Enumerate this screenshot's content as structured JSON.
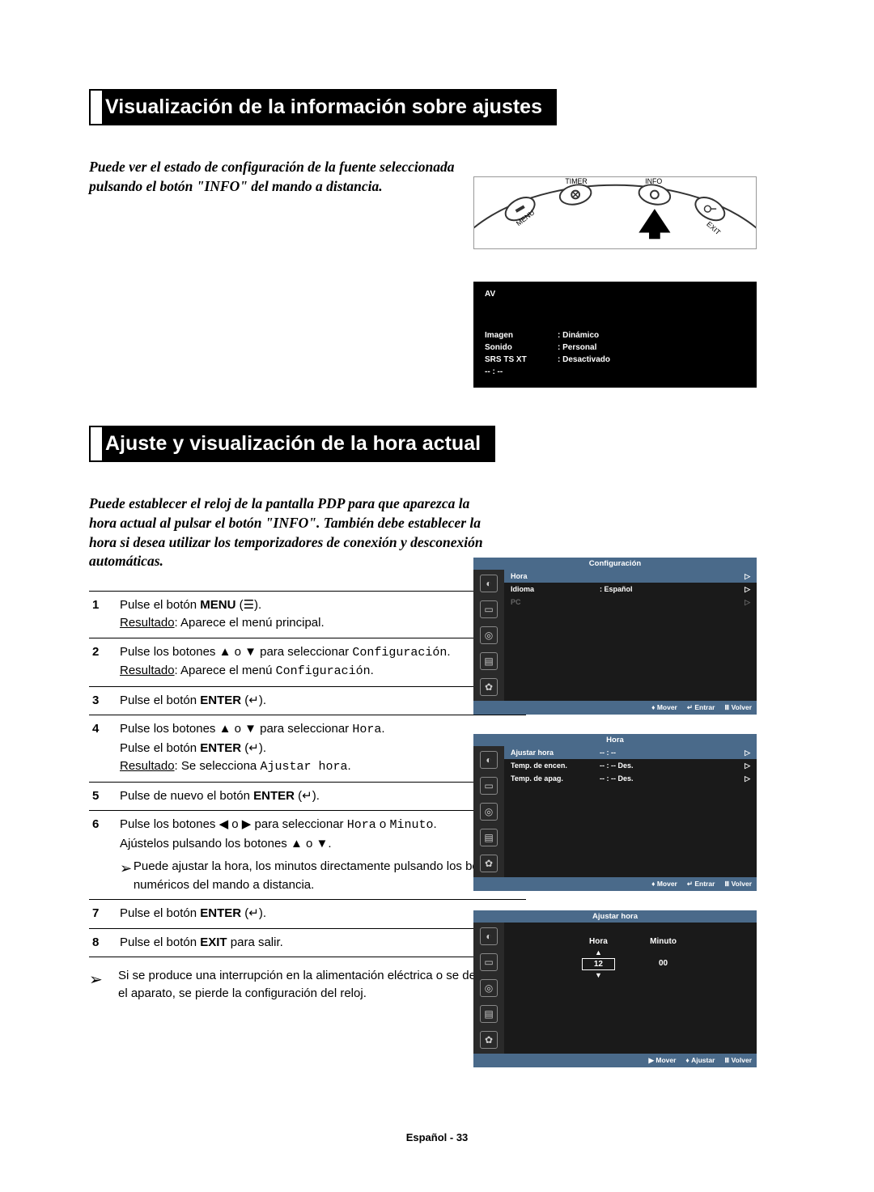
{
  "section1": {
    "title": "Visualización de la información sobre ajustes",
    "intro": "Puede ver el estado de configuración de la fuente seleccionada pulsando el botón \"INFO\" del mando a distancia."
  },
  "remote": {
    "labels": {
      "timer": "TIMER",
      "info": "INFO",
      "menu": "MENU",
      "exit": "EXIT"
    }
  },
  "osd_info": {
    "source": "AV",
    "rows": [
      {
        "label": "Imagen",
        "value": ": Dinámico"
      },
      {
        "label": "Sonido",
        "value": ": Personal"
      },
      {
        "label": "SRS TS XT",
        "value": ": Desactivado"
      },
      {
        "label": "-- : --",
        "value": ""
      }
    ]
  },
  "section2": {
    "title": "Ajuste y visualización de la hora actual",
    "intro": "Puede establecer el reloj de la pantalla PDP para que aparezca la hora actual al pulsar el botón \"INFO\". También debe establecer la hora si desea utilizar los temporizadores de conexión y desconexión automáticas.",
    "steps": [
      {
        "num": "1",
        "text_a": "Pulse el botón ",
        "bold_a": "MENU",
        "text_b": " (",
        "bold_icon": "☰",
        "text_c": ").",
        "result_label": "Resultado",
        "result_text": ":  Aparece el menú principal."
      },
      {
        "num": "2",
        "text_a": "Pulse los botones ▲ o ▼ para seleccionar ",
        "mono_a": "Configuración",
        "text_b": ".",
        "result_label": "Resultado",
        "result_text": ":  Aparece el menú ",
        "result_mono": "Configuración",
        "result_tail": "."
      },
      {
        "num": "3",
        "text_a": "Pulse el botón ",
        "bold_a": "ENTER",
        "text_b": " (↵)."
      },
      {
        "num": "4",
        "text_a": "Pulse los botones ▲ o ▼ para seleccionar ",
        "mono_a": "Hora",
        "text_b": ".",
        "line2_a": "Pulse el botón ",
        "line2_bold": "ENTER",
        "line2_b": " (↵).",
        "result_label": "Resultado",
        "result_text": ":  Se selecciona ",
        "result_mono": "Ajustar hora",
        "result_tail": "."
      },
      {
        "num": "5",
        "text_a": "Pulse de nuevo el botón ",
        "bold_a": "ENTER",
        "text_b": " (↵)."
      },
      {
        "num": "6",
        "text_a": "Pulse los botones ◀ o ▶ para seleccionar ",
        "mono_a": "Hora",
        "mid": " o ",
        "mono_b": "Minuto",
        "text_b": ".",
        "line2_plain": "Ajústelos pulsando los botones ▲ o ▼.",
        "inner_note_arrow": "➢",
        "inner_note": "Puede ajustar la hora, los minutos directamente pulsando los botones numéricos del mando a distancia."
      },
      {
        "num": "7",
        "text_a": "Pulse el botón ",
        "bold_a": "ENTER",
        "text_b": " (↵)."
      },
      {
        "num": "8",
        "text_a": "Pulse el botón ",
        "bold_a": "EXIT",
        "text_b": " para salir."
      }
    ],
    "footnote_arrow": "➢",
    "footnote": "Si se produce una interrupción en la alimentación eléctrica o se desconecta el aparato, se pierde la configuración del reloj."
  },
  "menu_config": {
    "title": "Configuración",
    "items": [
      {
        "label": "Hora",
        "value": "",
        "selected": true,
        "arrow": "▷"
      },
      {
        "label": "Idioma",
        "value": ": Español",
        "arrow": "▷"
      },
      {
        "label": "PC",
        "value": "",
        "dim": true,
        "arrow": "▷"
      }
    ],
    "footer": {
      "move": "Mover",
      "enter": "Entrar",
      "back": "Volver"
    }
  },
  "menu_hora": {
    "title": "Hora",
    "items": [
      {
        "label": "Ajustar hora",
        "value": "-- : --",
        "selected": true,
        "arrow": "▷"
      },
      {
        "label": "Temp. de encen.",
        "value": "-- : --   Des.",
        "arrow": "▷"
      },
      {
        "label": "Temp. de apag.",
        "value": "-- : --   Des.",
        "arrow": "▷"
      }
    ],
    "footer": {
      "move": "Mover",
      "enter": "Entrar",
      "back": "Volver"
    }
  },
  "menu_adjust": {
    "title": "Ajustar hora",
    "hora_label": "Hora",
    "hora_value": "12",
    "minuto_label": "Minuto",
    "minuto_value": "00",
    "footer": {
      "move": "Mover",
      "adjust": "Ajustar",
      "back": "Volver"
    }
  },
  "page_footer": "Español - 33"
}
